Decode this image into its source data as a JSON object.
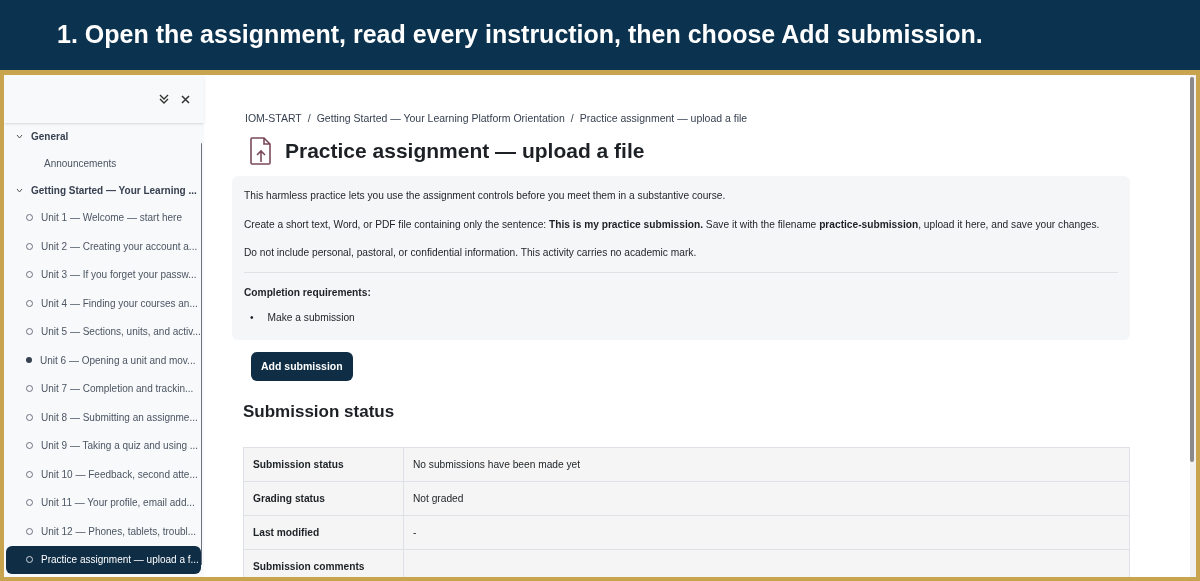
{
  "banner": {
    "title": "1. Open the assignment, read every instruction, then choose Add submission."
  },
  "sidebar": {
    "sections": [
      {
        "title": "General",
        "expanded": true,
        "items": [
          {
            "label": "Announcements",
            "kind": "plain",
            "selected": false
          }
        ]
      },
      {
        "title": "Getting Started — Your Learning ...",
        "expanded": true,
        "items": [
          {
            "label": "Unit 1 — Welcome — start here",
            "kind": "activity",
            "current": false,
            "selected": false
          },
          {
            "label": "Unit 2 — Creating your account a...",
            "kind": "activity",
            "current": false,
            "selected": false
          },
          {
            "label": "Unit 3 — If you forget your passw...",
            "kind": "activity",
            "current": false,
            "selected": false
          },
          {
            "label": "Unit 4 — Finding your courses an...",
            "kind": "activity",
            "current": false,
            "selected": false
          },
          {
            "label": "Unit 5 — Sections, units, and activ...",
            "kind": "activity",
            "current": false,
            "selected": false
          },
          {
            "label": "Unit 6 — Opening a unit and mov...",
            "kind": "activity",
            "current": true,
            "selected": false
          },
          {
            "label": "Unit 7 — Completion and trackin...",
            "kind": "activity",
            "current": false,
            "selected": false
          },
          {
            "label": "Unit 8 — Submitting an assignme...",
            "kind": "activity",
            "current": false,
            "selected": false
          },
          {
            "label": "Unit 9 — Taking a quiz and using ...",
            "kind": "activity",
            "current": false,
            "selected": false
          },
          {
            "label": "Unit 10 — Feedback, second atte...",
            "kind": "activity",
            "current": false,
            "selected": false
          },
          {
            "label": "Unit 11 — Your profile, email add...",
            "kind": "activity",
            "current": false,
            "selected": false
          },
          {
            "label": "Unit 12 — Phones, tablets, troubl...",
            "kind": "activity",
            "current": false,
            "selected": false
          },
          {
            "label": "Practice assignment — upload a f...",
            "kind": "activity",
            "current": false,
            "selected": true
          }
        ]
      }
    ]
  },
  "breadcrumb_separator": "/",
  "breadcrumb": [
    "IOM-START",
    "Getting Started — Your Learning Platform Orientation",
    "Practice assignment — upload a file"
  ],
  "title": "Practice assignment — upload a file",
  "description": [
    "This harmless practice lets you use the assignment controls before you meet them in a substantive course.",
    "Create a short text, Word, or PDF file containing only the sentence: **This is my practice submission.** Save it with the filename **practice-submission**, upload it here, and save your changes.",
    "Do not include personal, pastoral, or confidential information. This activity carries no academic mark."
  ],
  "completion": {
    "heading": "Completion requirements:",
    "bullet": "•",
    "items": [
      "Make a submission"
    ]
  },
  "add_button": "Add submission",
  "status": {
    "heading": "Submission status",
    "rows": [
      {
        "label": "Submission status",
        "value": "No submissions have been made yet"
      },
      {
        "label": "Grading status",
        "value": "Not graded"
      },
      {
        "label": "Last modified",
        "value": "-"
      },
      {
        "label": "Submission comments"
      }
    ]
  }
}
